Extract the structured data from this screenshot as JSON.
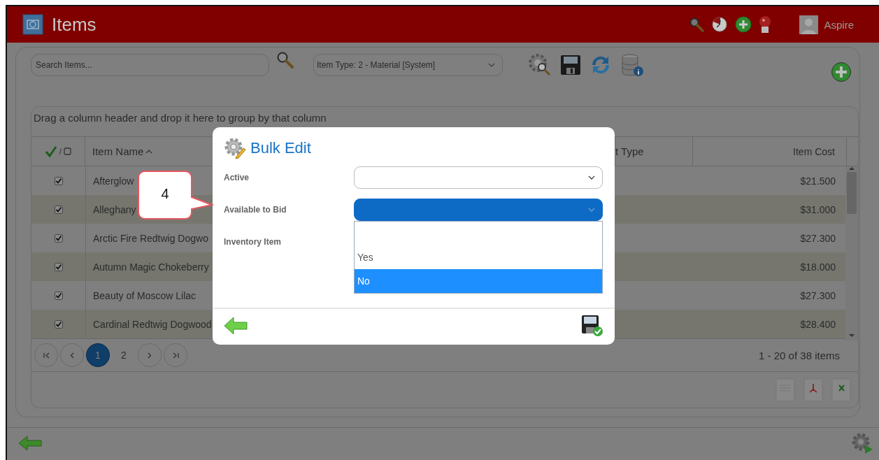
{
  "header": {
    "title": "Items",
    "user": "Aspire"
  },
  "toolbar": {
    "search": {
      "placeholder": "Search Items..."
    },
    "item_type": "Item Type: 2 - Material [System]"
  },
  "grid": {
    "group_hint": "Drag a column header and drop it here to group by that column",
    "select_separator": "/",
    "columns": [
      {
        "label": "Item Name",
        "sorted": true
      },
      {
        "label": "t Type",
        "sorted": false
      },
      {
        "label": "Item Cost",
        "sorted": false
      }
    ],
    "rows": [
      {
        "checked": true,
        "name": "Afterglow",
        "cost": "$21.500"
      },
      {
        "checked": true,
        "name": "Alleghany",
        "cost": "$31.000"
      },
      {
        "checked": true,
        "name": "Arctic Fire Redtwig Dogwo",
        "cost": "$27.300"
      },
      {
        "checked": true,
        "name": "Autumn Magic Chokeberry",
        "cost": "$18.000"
      },
      {
        "checked": true,
        "name": "Beauty of Moscow Lilac",
        "cost": "$27.300"
      },
      {
        "checked": true,
        "name": "Cardinal Redtwig Dogwood",
        "cost": "$28.400"
      }
    ],
    "pages": [
      {
        "label": "1",
        "selected": true
      },
      {
        "label": "2",
        "selected": false
      }
    ],
    "summary": "1 - 20 of 38 items"
  },
  "dialog": {
    "title": "Bulk Edit",
    "fields": [
      {
        "kind": "select",
        "label": "Active"
      },
      {
        "kind": "open-select",
        "label": "Available to Bid",
        "options": [
          {
            "label": "Yes",
            "selected": false
          },
          {
            "label": "No",
            "selected": true
          }
        ]
      },
      {
        "kind": "label",
        "label": "Inventory Item"
      }
    ]
  },
  "callout": {
    "number": "4"
  }
}
